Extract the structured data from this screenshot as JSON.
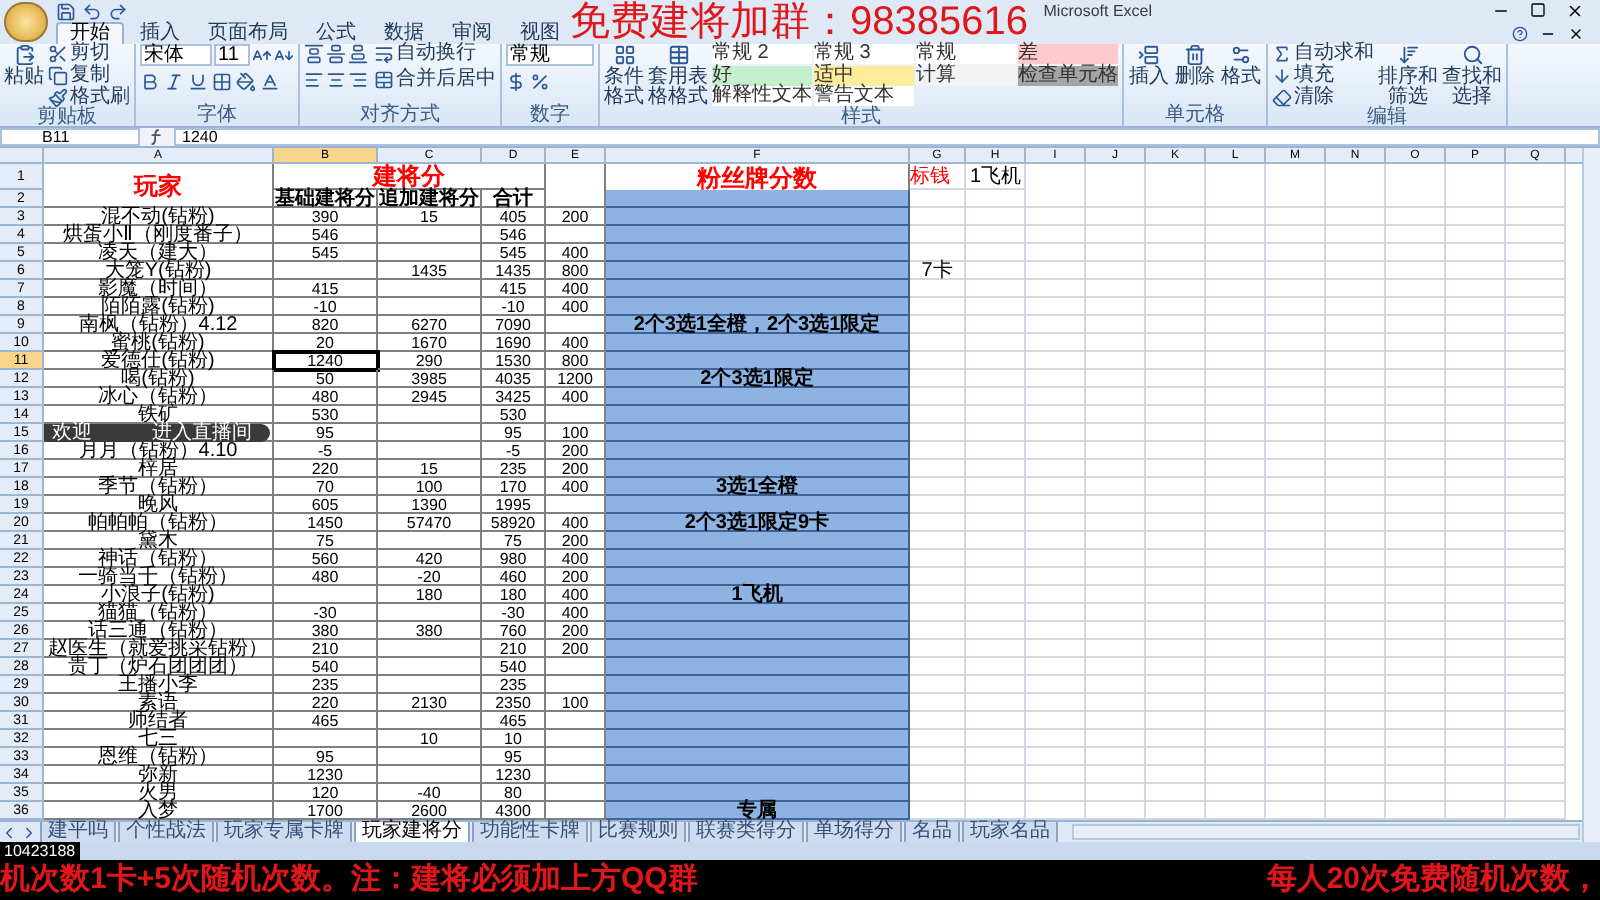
{
  "window": {
    "title": "Microsoft Excel"
  },
  "overlay_title": "免费建将加群：98385616",
  "ribbon": {
    "tabs": [
      {
        "label": "开始",
        "selected": true
      },
      {
        "label": "插入",
        "selected": false
      },
      {
        "label": "页面布局",
        "selected": false
      },
      {
        "label": "公式",
        "selected": false
      },
      {
        "label": "数据",
        "selected": false
      },
      {
        "label": "审阅",
        "selected": false
      },
      {
        "label": "视图",
        "selected": false
      }
    ],
    "groups": [
      {
        "kind": "clipboard",
        "label": "剪贴板",
        "big": [
          "粘贴"
        ],
        "small": [
          "剪切",
          "复制",
          "格式刷"
        ]
      },
      {
        "kind": "font",
        "label": "字体",
        "fields": [
          "宋体",
          "11"
        ]
      },
      {
        "kind": "align",
        "label": "对齐方式",
        "small": [
          "自动换行",
          "合并后居中"
        ]
      },
      {
        "kind": "number",
        "label": "数字",
        "fields": [
          "常规"
        ]
      },
      {
        "kind": "styles",
        "label": "样式",
        "big": [
          "条件格式",
          "套用表格格式"
        ],
        "swatches": [
          {
            "label": "常规 2",
            "color": "#ffffff"
          },
          {
            "label": "常规 3",
            "color": "#ffffff"
          },
          {
            "label": "常规",
            "color": "#ffffff"
          },
          {
            "label": "差",
            "color": "#ffc7ce"
          },
          {
            "label": "好",
            "color": "#c6efce"
          },
          {
            "label": "适中",
            "color": "#ffeb9c"
          },
          {
            "label": "计算",
            "color": "#f2f2f2"
          },
          {
            "label": "检查单元格",
            "color": "#a5a5a5"
          },
          {
            "label": "解释性文本",
            "color": "#ffffff"
          },
          {
            "label": "警告文本",
            "color": "#ffffff"
          }
        ]
      },
      {
        "kind": "cells",
        "label": "单元格",
        "big": [
          "插入",
          "删除",
          "格式"
        ]
      },
      {
        "kind": "editing",
        "label": "编辑",
        "small": [
          "自动求和",
          "填充",
          "清除"
        ],
        "big": [
          "排序和筛选",
          "查找和选择"
        ]
      }
    ]
  },
  "formula_bar": {
    "name_box": "B11",
    "value": "1240"
  },
  "columns": [
    {
      "label": "A",
      "selected": false
    },
    {
      "label": "B",
      "selected": true
    },
    {
      "label": "C",
      "selected": false
    },
    {
      "label": "D",
      "selected": false
    },
    {
      "label": "E",
      "selected": false
    },
    {
      "label": "F",
      "selected": false
    },
    {
      "label": "G",
      "selected": false
    },
    {
      "label": "H",
      "selected": false
    },
    {
      "label": "I",
      "selected": false
    },
    {
      "label": "J",
      "selected": false
    },
    {
      "label": "K",
      "selected": false
    },
    {
      "label": "L",
      "selected": false
    },
    {
      "label": "M",
      "selected": false
    },
    {
      "label": "N",
      "selected": false
    },
    {
      "label": "O",
      "selected": false
    },
    {
      "label": "P",
      "selected": false
    },
    {
      "label": "Q",
      "selected": false
    }
  ],
  "header": {
    "row_1": "1",
    "row_2": "2",
    "a": "玩家",
    "bd": "建将分",
    "b2": "基础建将分",
    "c2": "追加建将分",
    "d2": "合计",
    "f": "粉丝牌分数",
    "g": "标钱",
    "h": "1飞机"
  },
  "rows": [
    {
      "n": "3",
      "a": "混不动(钻粉)",
      "b": "390",
      "c": "15",
      "d": "405",
      "e": "200",
      "selected": false
    },
    {
      "n": "4",
      "a": "烘蛋小Ⅱ（刚度番子）",
      "b": "546",
      "d": "546",
      "selected": false
    },
    {
      "n": "5",
      "a": "凌天（建大）",
      "b": "545",
      "d": "545",
      "e": "400",
      "selected": false
    },
    {
      "n": "6",
      "a": "大笼Y(钻粉)",
      "c": "1435",
      "d": "1435",
      "e": "800",
      "g": "7卡",
      "selected": false
    },
    {
      "n": "7",
      "a": "影魔（时间）",
      "b": "415",
      "d": "415",
      "e": "400",
      "selected": false
    },
    {
      "n": "8",
      "a": "陌陌露(钻粉)",
      "b": "-10",
      "d": "-10",
      "e": "400",
      "selected": false
    },
    {
      "n": "9",
      "a": "南枫（钻粉）4.12",
      "b": "820",
      "c": "6270",
      "d": "7090",
      "f": "2个3选1全橙，2个3选1限定",
      "selected": false
    },
    {
      "n": "10",
      "a": "蜜桃(钻粉)",
      "b": "20",
      "c": "1670",
      "d": "1690",
      "e": "400",
      "selected": false
    },
    {
      "n": "11",
      "a": "爱德仕(钻粉)",
      "b": "1240",
      "c": "290",
      "d": "1530",
      "e": "800",
      "selected": true
    },
    {
      "n": "12",
      "a": "喝(钻粉)",
      "b": "50",
      "c": "3985",
      "d": "4035",
      "e": "1200",
      "f": "2个3选1限定",
      "selected": false
    },
    {
      "n": "13",
      "a": "冰心（钻粉）",
      "b": "480",
      "c": "2945",
      "d": "3425",
      "e": "400",
      "selected": false
    },
    {
      "n": "14",
      "a": "铁矿",
      "b": "530",
      "d": "530",
      "selected": false
    },
    {
      "n": "15",
      "b": "95",
      "d": "95",
      "e": "100",
      "selected": false
    },
    {
      "n": "16",
      "a": "月月（钻粉）4.10",
      "b": "-5",
      "d": "-5",
      "e": "200",
      "selected": false
    },
    {
      "n": "17",
      "a": "梓居",
      "b": "220",
      "c": "15",
      "d": "235",
      "e": "200",
      "selected": false
    },
    {
      "n": "18",
      "a": "季节（钻粉）",
      "b": "70",
      "c": "100",
      "d": "170",
      "e": "400",
      "f": "3选1全橙",
      "selected": false
    },
    {
      "n": "19",
      "a": "晚风",
      "b": "605",
      "c": "1390",
      "d": "1995",
      "selected": false
    },
    {
      "n": "20",
      "a": "帕帕帕（钻粉）",
      "b": "1450",
      "c": "57470",
      "d": "58920",
      "e": "400",
      "f": "2个3选1限定9卡",
      "selected": false
    },
    {
      "n": "21",
      "a": "黛木",
      "b": "75",
      "d": "75",
      "e": "200",
      "selected": false
    },
    {
      "n": "22",
      "a": "神话（钻粉）",
      "b": "560",
      "c": "420",
      "d": "980",
      "e": "400",
      "selected": false
    },
    {
      "n": "23",
      "a": "一骑当千（钻粉）",
      "b": "480",
      "c": "-20",
      "d": "460",
      "e": "200",
      "selected": false
    },
    {
      "n": "24",
      "a": "小浪子(钻粉)",
      "c": "180",
      "d": "180",
      "e": "400",
      "f": "1飞机",
      "selected": false
    },
    {
      "n": "25",
      "a": "猫猫（钻粉）",
      "b": "-30",
      "d": "-30",
      "e": "400",
      "selected": false
    },
    {
      "n": "26",
      "a": "话三通（钻粉）",
      "b": "380",
      "c": "380",
      "d": "760",
      "e": "200",
      "selected": false
    },
    {
      "n": "27",
      "a": "赵医生（就爱挑采钻粉）",
      "b": "210",
      "d": "210",
      "e": "200",
      "selected": false
    },
    {
      "n": "28",
      "a": "贵丁（炉石团团团）",
      "b": "540",
      "d": "540",
      "selected": false
    },
    {
      "n": "29",
      "a": "王播小李",
      "b": "235",
      "d": "235",
      "selected": false
    },
    {
      "n": "30",
      "a": "素语",
      "b": "220",
      "c": "2130",
      "d": "2350",
      "e": "100",
      "selected": false
    },
    {
      "n": "31",
      "a": "师结者",
      "b": "465",
      "d": "465",
      "selected": false
    },
    {
      "n": "32",
      "a": "七三",
      "c": "10",
      "d": "10",
      "selected": false
    },
    {
      "n": "33",
      "a": "恩维（钻粉）",
      "b": "95",
      "d": "95",
      "selected": false
    },
    {
      "n": "34",
      "a": "弥新",
      "b": "1230",
      "d": "1230",
      "selected": false
    },
    {
      "n": "35",
      "a": "火男",
      "b": "120",
      "c": "-40",
      "d": "80",
      "selected": false
    },
    {
      "n": "36",
      "a": "入梦",
      "b": "1700",
      "c": "2600",
      "d": "4300",
      "f": "专属",
      "selected": false
    }
  ],
  "toast": {
    "prefix": "欢迎",
    "suffix": "进入直播间"
  },
  "sheet_tabs": [
    {
      "label": "建平吗",
      "selected": false
    },
    {
      "label": "个性战法",
      "selected": false
    },
    {
      "label": "玩家专属卡牌",
      "selected": false
    },
    {
      "label": "玩家建将分",
      "selected": true
    },
    {
      "label": "功能性卡牌",
      "selected": false
    },
    {
      "label": "比赛规则",
      "selected": false
    },
    {
      "label": "联赛类得分",
      "selected": false
    },
    {
      "label": "单场得分",
      "selected": false
    },
    {
      "label": "名品",
      "selected": false
    },
    {
      "label": "玩家名品",
      "selected": false
    }
  ],
  "stream_id": "10423188",
  "ticker": {
    "left": "机次数1卡+5次随机次数。注：建将必须加上方QQ群",
    "right": "每人20次免费随机次数，"
  }
}
